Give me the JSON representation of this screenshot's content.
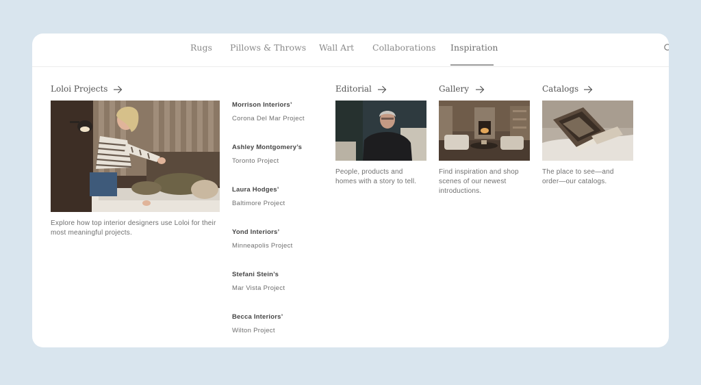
{
  "nav": {
    "items": [
      {
        "label": "Rugs"
      },
      {
        "label": "Pillows & Throws"
      },
      {
        "label": "Wall Art"
      },
      {
        "label": "Collaborations"
      },
      {
        "label": "Inspiration",
        "active": true
      }
    ]
  },
  "loloi_projects": {
    "title": "Loloi Projects",
    "description": "Explore how top interior designers use Loloi for their most meaningful projects."
  },
  "projects": [
    {
      "designer": "Morrison Interiors’",
      "project": "Corona Del Mar Project"
    },
    {
      "designer": "Ashley Montgomery’s",
      "project": "Toronto Project"
    },
    {
      "designer": "Laura Hodges’",
      "project": "Baltimore Project"
    },
    {
      "designer": "Yond Interiors’",
      "project": "Minneapolis Project"
    },
    {
      "designer": "Stefani Stein’s",
      "project": "Mar Vista Project"
    },
    {
      "designer": "Becca Interiors’",
      "project": "Wilton Project"
    }
  ],
  "editorial": {
    "title": "Editorial",
    "description": "People, products and homes with a story to tell."
  },
  "gallery": {
    "title": "Gallery",
    "description": "Find inspiration and shop scenes of our newest introductions."
  },
  "catalogs": {
    "title": "Catalogs",
    "description": "The place to see—and order—our catalogs."
  },
  "colors": {
    "page_bg": "#d9e5ee",
    "card_bg": "#ffffff",
    "text": "#555555"
  }
}
